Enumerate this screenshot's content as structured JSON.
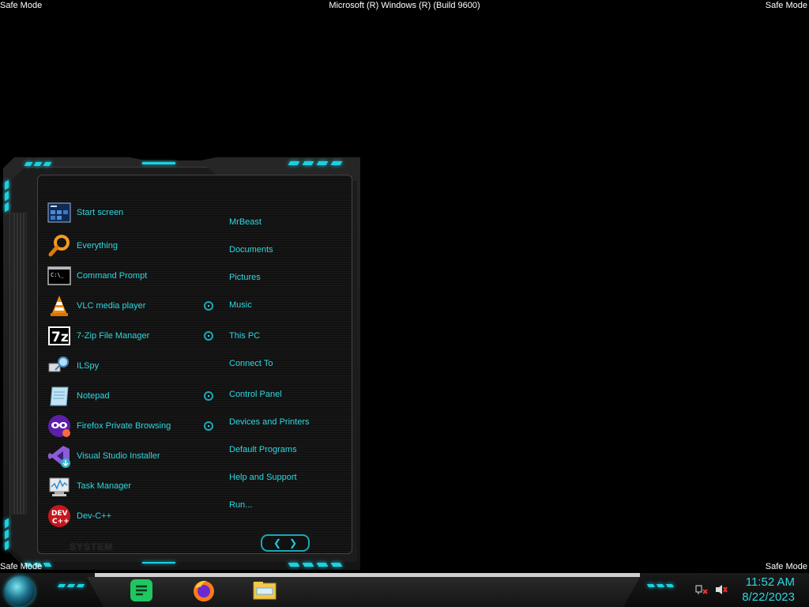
{
  "safe_mode": "Safe Mode",
  "build_string": "Microsoft (R) Windows (R) (Build 9600)",
  "start_menu": {
    "programs": [
      {
        "label": "Start screen",
        "icon": "start-screen-icon",
        "pinned": false
      },
      {
        "label": "Everything",
        "icon": "magnifier-icon",
        "pinned": false
      },
      {
        "label": "Command Prompt",
        "icon": "cmd-icon",
        "pinned": false
      },
      {
        "label": "VLC media player",
        "icon": "vlc-cone-icon",
        "pinned": true
      },
      {
        "label": "7-Zip File Manager",
        "icon": "7zip-icon",
        "pinned": true
      },
      {
        "label": "ILSpy",
        "icon": "ilspy-icon",
        "pinned": false
      },
      {
        "label": "Notepad",
        "icon": "notepad-icon",
        "pinned": true
      },
      {
        "label": "Firefox Private Browsing",
        "icon": "firefox-private-icon",
        "pinned": true
      },
      {
        "label": "Visual Studio Installer",
        "icon": "vs-installer-icon",
        "pinned": false
      },
      {
        "label": "Task Manager",
        "icon": "task-manager-icon",
        "pinned": false
      },
      {
        "label": "Dev-C++",
        "icon": "devcpp-icon",
        "pinned": false
      }
    ],
    "places": [
      "MrBeast",
      "Documents",
      "Pictures",
      "Music",
      "This PC",
      "Connect To",
      "Control Panel",
      "Devices and Printers",
      "Default Programs",
      "Help and Support",
      "Run..."
    ],
    "system_label": "SYSTEM",
    "nav_left": "❮",
    "nav_right": "❯"
  },
  "taskbar": {
    "apps": [
      "notes-app-icon",
      "firefox-icon",
      "file-explorer-icon"
    ],
    "time": "11:52 AM",
    "date": "8/22/2023"
  },
  "accent_color": "#1bd1e0",
  "text_color": "#2dd8e0"
}
